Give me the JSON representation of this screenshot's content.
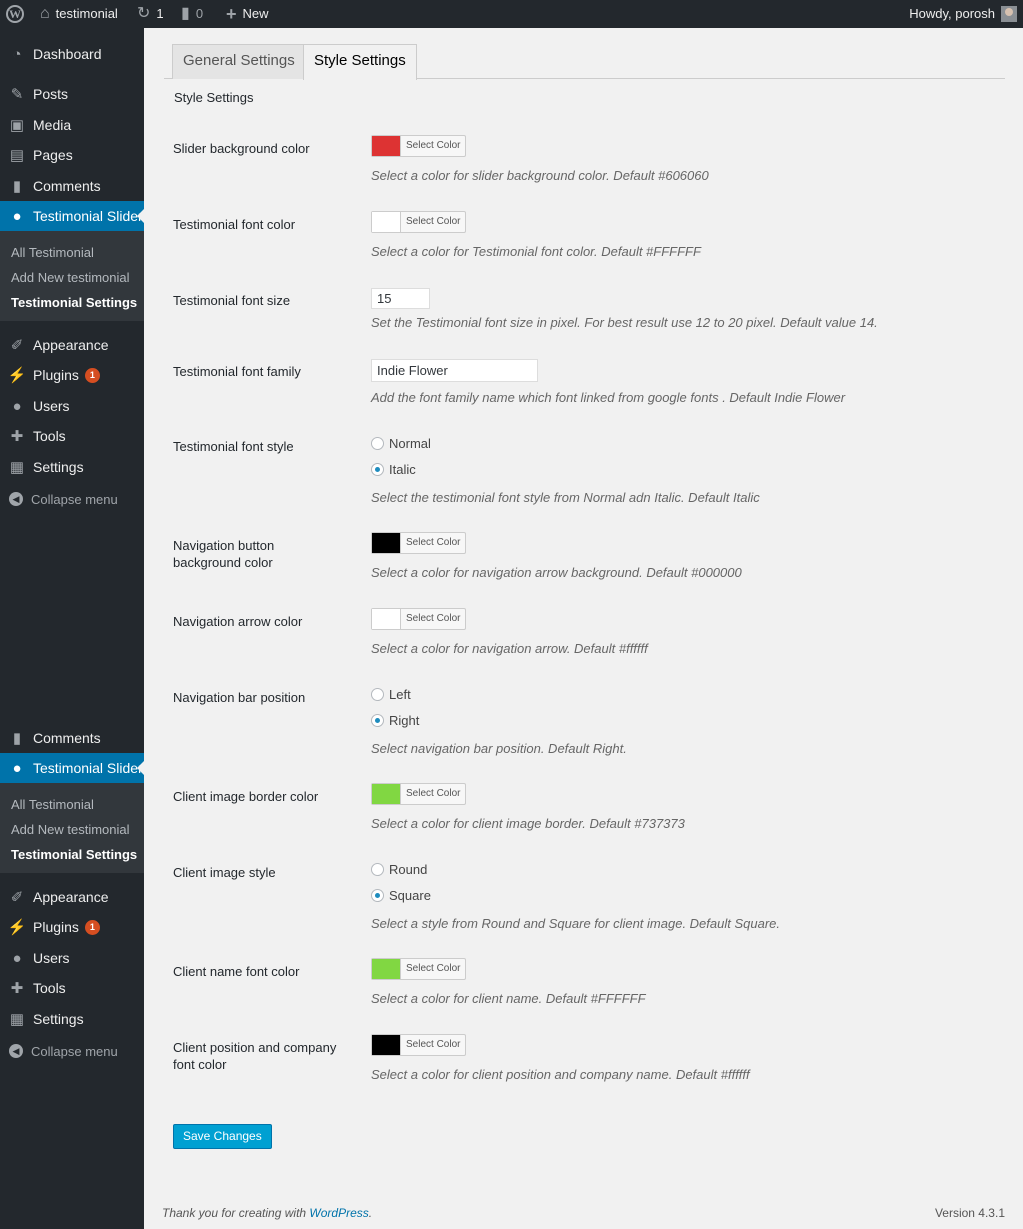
{
  "adminbar": {
    "site_name": "testimonial",
    "updates_count": "1",
    "comments_count": "0",
    "new_label": "New",
    "howdy": "Howdy, porosh"
  },
  "sidebar": {
    "dashboard": "Dashboard",
    "posts": "Posts",
    "media": "Media",
    "pages": "Pages",
    "comments": "Comments",
    "testimonial_slider": "Testimonial Slider",
    "sub": {
      "all": "All Testimonial",
      "add_new": "Add New testimonial",
      "settings": "Testimonial Settings"
    },
    "appearance": "Appearance",
    "plugins": "Plugins",
    "plugins_badge": "1",
    "users": "Users",
    "tools": "Tools",
    "settings": "Settings",
    "collapse": "Collapse menu"
  },
  "tabs": {
    "general": "General Settings",
    "style": "Style Settings"
  },
  "section_title": "Style Settings",
  "select_color_label": "Select Color",
  "fields": {
    "slider_bg": {
      "label": "Slider background color",
      "color": "#dd3333",
      "desc": "Select a color for slider background color. Default #606060"
    },
    "font_color": {
      "label": "Testimonial font color",
      "color": "#ffffff",
      "desc": "Select a color for Testimonial font color. Default #FFFFFF"
    },
    "font_size": {
      "label": "Testimonial font size",
      "value": "15",
      "desc": "Set the Testimonial font size in pixel. For best result use 12 to 20 pixel. Default value 14."
    },
    "font_family": {
      "label": "Testimonial font family",
      "value": "Indie Flower",
      "desc": "Add the font family name which font linked from google fonts . Default Indie Flower"
    },
    "font_style": {
      "label": "Testimonial font style",
      "options": [
        "Normal",
        "Italic"
      ],
      "selected": "Italic",
      "desc": "Select the testimonial font style from Normal adn Italic. Default Italic"
    },
    "nav_bg": {
      "label_line1": "Navigation button",
      "label_line2": "background color",
      "color": "#000000",
      "desc": "Select a color for navigation arrow background. Default #000000"
    },
    "nav_arrow": {
      "label": "Navigation arrow color",
      "color": "#ffffff",
      "desc": "Select a color for navigation arrow. Default #ffffff"
    },
    "nav_position": {
      "label": "Navigation bar position",
      "options": [
        "Left",
        "Right"
      ],
      "selected": "Right",
      "desc": "Select navigation bar position. Default Right."
    },
    "client_border": {
      "label": "Client image border color",
      "color": "#81d742",
      "desc": "Select a color for client image border. Default #737373"
    },
    "client_style": {
      "label": "Client image style",
      "options": [
        "Round",
        "Square"
      ],
      "selected": "Square",
      "desc": "Select a style from Round and Square for client image. Default Square."
    },
    "client_name_color": {
      "label": "Client name font color",
      "color": "#81d742",
      "desc": "Select a color for client name. Default #FFFFFF"
    },
    "client_position_color": {
      "label_line1": "Client position and company",
      "label_line2": "font color",
      "color": "#000000",
      "desc": "Select a color for client position and company name. Default #ffffff"
    }
  },
  "save_label": "Save Changes",
  "footer": {
    "thanks_prefix": "Thank you for creating with ",
    "thanks_link": "WordPress",
    "thanks_suffix": ".",
    "version": "Version 4.3.1"
  }
}
